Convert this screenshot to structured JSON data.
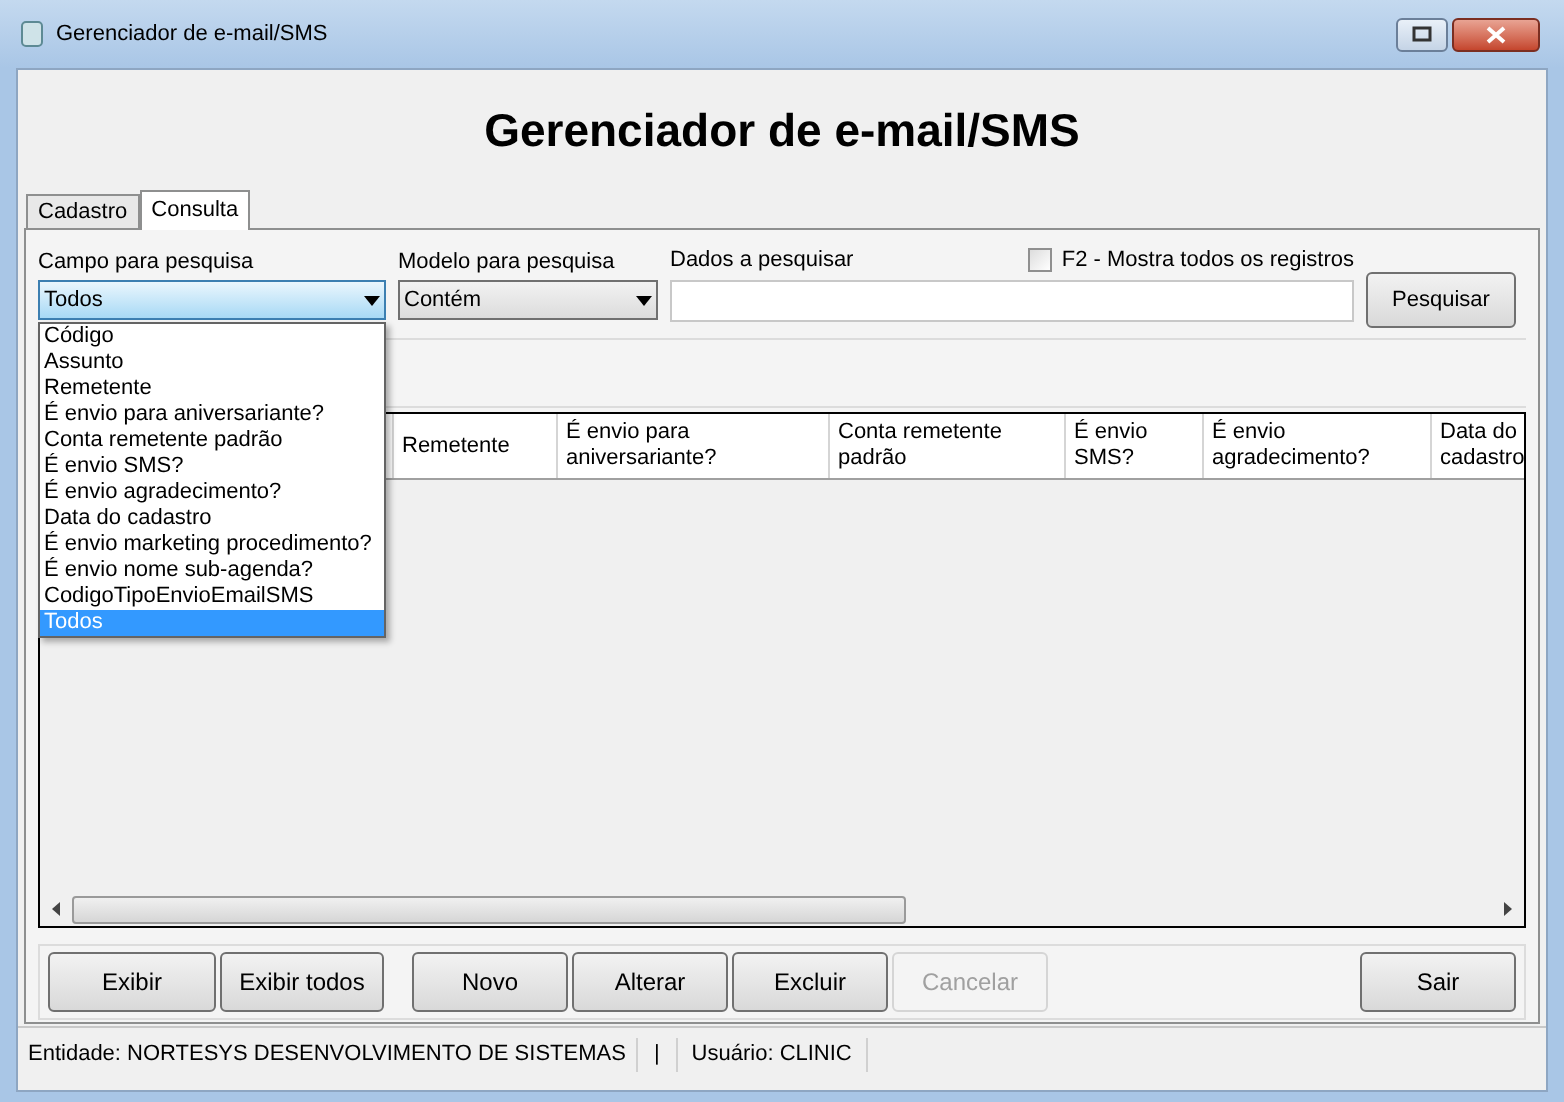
{
  "window": {
    "title": "Gerenciador de e-mail/SMS"
  },
  "heading": "Gerenciador de e-mail/SMS",
  "tabs": [
    {
      "label": "Cadastro",
      "selected": false
    },
    {
      "label": "Consulta",
      "selected": true
    }
  ],
  "search": {
    "field_label": "Campo para pesquisa",
    "field_value": "Todos",
    "model_label": "Modelo para pesquisa",
    "model_value": "Contém",
    "data_label": "Dados a pesquisar",
    "show_all": {
      "label": "F2 - Mostra todos os registros",
      "checked": false
    },
    "search_button": "Pesquisar"
  },
  "dropdown": {
    "options": [
      {
        "label": "Código",
        "selected": false
      },
      {
        "label": "Assunto",
        "selected": false
      },
      {
        "label": "Remetente",
        "selected": false
      },
      {
        "label": "É envio para aniversariante?",
        "selected": false
      },
      {
        "label": "Conta remetente padrão",
        "selected": false
      },
      {
        "label": "É envio SMS?",
        "selected": false
      },
      {
        "label": "É envio agradecimento?",
        "selected": false
      },
      {
        "label": "Data do cadastro",
        "selected": false
      },
      {
        "label": "É envio marketing procedimento?",
        "selected": false
      },
      {
        "label": "É envio nome sub-agenda?",
        "selected": false
      },
      {
        "label": "CodigoTipoEnvioEmailSMS",
        "selected": false
      },
      {
        "label": "Todos",
        "selected": true
      }
    ]
  },
  "table": {
    "columns": [
      "Remetente",
      "É envio para aniversariante?",
      "Conta remetente padrão",
      "É envio SMS?",
      "É envio agradecimento?",
      "Data do cadastro"
    ]
  },
  "buttons": [
    {
      "label": "Exibir",
      "disabled": false
    },
    {
      "label": "Exibir todos",
      "disabled": false
    },
    {
      "label": "Novo",
      "disabled": false
    },
    {
      "label": "Alterar",
      "disabled": false
    },
    {
      "label": "Excluir",
      "disabled": false
    },
    {
      "label": "Cancelar",
      "disabled": true
    },
    {
      "label": "Sair",
      "disabled": false
    }
  ],
  "status_bar": {
    "entity": "Entidade: NORTESYS DESENVOLVIMENTO DE SISTEMAS",
    "separator": "|",
    "user": "Usuário: CLINIC"
  }
}
